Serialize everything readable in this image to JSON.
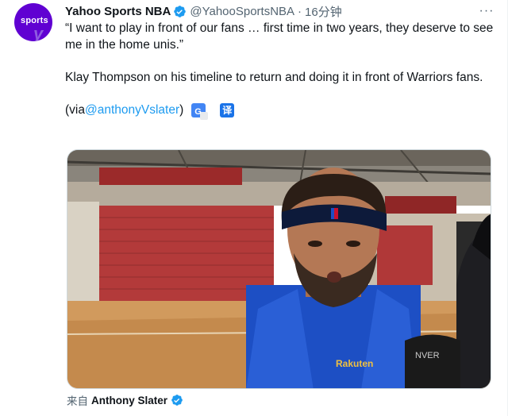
{
  "tweet": {
    "author": {
      "display_name": "Yahoo Sports NBA",
      "handle": "@YahooSportsNBA",
      "avatar_text": "sports",
      "verified": true
    },
    "separator": "·",
    "time": "16分钟",
    "text_line1": "“I want to play in front of our fans … first time in two years, they deserve to see me in the home unis.”",
    "text_line2": "Klay Thompson on his timeline to return and doing it in front of Warriors fans.",
    "via_prefix": "(via ",
    "via_mention": "@anthonyVslater",
    "via_suffix": ")",
    "translate_icons": [
      "google-translate-icon",
      "translate-yi-icon"
    ],
    "translate_yi_label": "译",
    "more_label": "···",
    "media": {
      "description_icon": "video-thumbnail",
      "jersey_text": "Rakuten"
    },
    "source": {
      "prefix": "来自",
      "name": "Anthony Slater",
      "verified": true
    }
  },
  "colors": {
    "link": "#1d9bf0",
    "secondary_text": "#536471",
    "verified_blue": "#1d9bf0",
    "avatar_purple": "#6001d2"
  }
}
